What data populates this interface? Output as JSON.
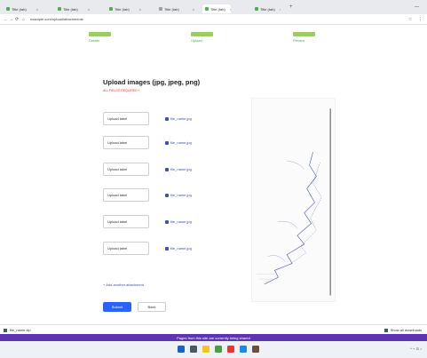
{
  "browser": {
    "tabs": [
      {
        "label": "Title (tab)",
        "active": false
      },
      {
        "label": "Title (tab)",
        "active": false
      },
      {
        "label": "Title (tab)",
        "active": false
      },
      {
        "label": "Title (tab)",
        "active": false
      },
      {
        "label": "Title (tab)",
        "active": true
      },
      {
        "label": "Title (tab)",
        "active": false
      }
    ],
    "url": "example.com/upload/attachments"
  },
  "steps": [
    {
      "label": "Details"
    },
    {
      "label": "Upload"
    },
    {
      "label": "Review"
    }
  ],
  "form": {
    "title": "Upload images (jpg, jpeg, png)",
    "required_note": "ALL FIELDS REQUIRED *",
    "rows": [
      {
        "field": "Upload label",
        "link": "file_name.jpg"
      },
      {
        "field": "Upload label",
        "link": "file_name.jpg"
      },
      {
        "field": "Upload label",
        "link": "file_name.jpg"
      },
      {
        "field": "Upload label",
        "link": "file_name.jpg"
      },
      {
        "field": "Upload label",
        "link": "file_name.jpg"
      },
      {
        "field": "Upload label",
        "link": "file_name.jpg"
      }
    ],
    "add_another": "+ Add another attachment",
    "primary_button": "Submit",
    "secondary_button": "Back"
  },
  "downloads": {
    "left": "file_name.zip",
    "right": "Show all downloads"
  },
  "banner": "Pages from this site are currently being shared",
  "icons": {
    "fav": "favicon-icon",
    "back": "back-arrow-icon",
    "forward": "forward-arrow-icon",
    "reload": "reload-icon",
    "home": "home-icon",
    "upload": "upload-icon"
  },
  "colors": {
    "accent": "#2962ff",
    "link": "#3f51b5",
    "step": "#9ccc65",
    "banner": "#5e35b1",
    "required": "#e53935"
  }
}
